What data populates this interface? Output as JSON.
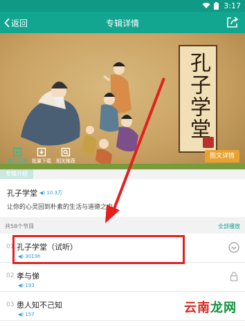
{
  "status_bar": {
    "time": "3:17"
  },
  "header": {
    "back_label": "返回",
    "title": "专辑详情"
  },
  "banner": {
    "scroll_title": "孔子学堂",
    "detail_button": "图文详情",
    "tools": [
      {
        "label": "加入订阅",
        "icon": "subscribe-icon"
      },
      {
        "label": "批量下载",
        "icon": "download-icon"
      },
      {
        "label": "相关推荐",
        "icon": "recommend-icon"
      }
    ]
  },
  "intro": {
    "tab_label": "专辑介绍",
    "album_title": "孔子学堂",
    "play_count": "10.3万",
    "description": "让你的心灵回到朴素的生活与道德之中"
  },
  "episodes": {
    "count_label": "共58个节目",
    "play_all": "全部播放",
    "items": [
      {
        "num": "01",
        "name": "孔子学堂（试听）",
        "plays": "3019h",
        "icon": "download-circle-icon"
      },
      {
        "num": "02",
        "name": "孝与悌",
        "plays": "193",
        "icon": "lock-icon"
      },
      {
        "num": "03",
        "name": "患人知不己知",
        "plays": "157",
        "icon": "lock-icon"
      }
    ]
  },
  "watermark": {
    "part1": "云南",
    "part2": "龙网"
  },
  "colors": {
    "header": "#12a58f",
    "accent": "#e9a22f",
    "annotation": "#e31f1f",
    "link": "#2a9ad8"
  }
}
